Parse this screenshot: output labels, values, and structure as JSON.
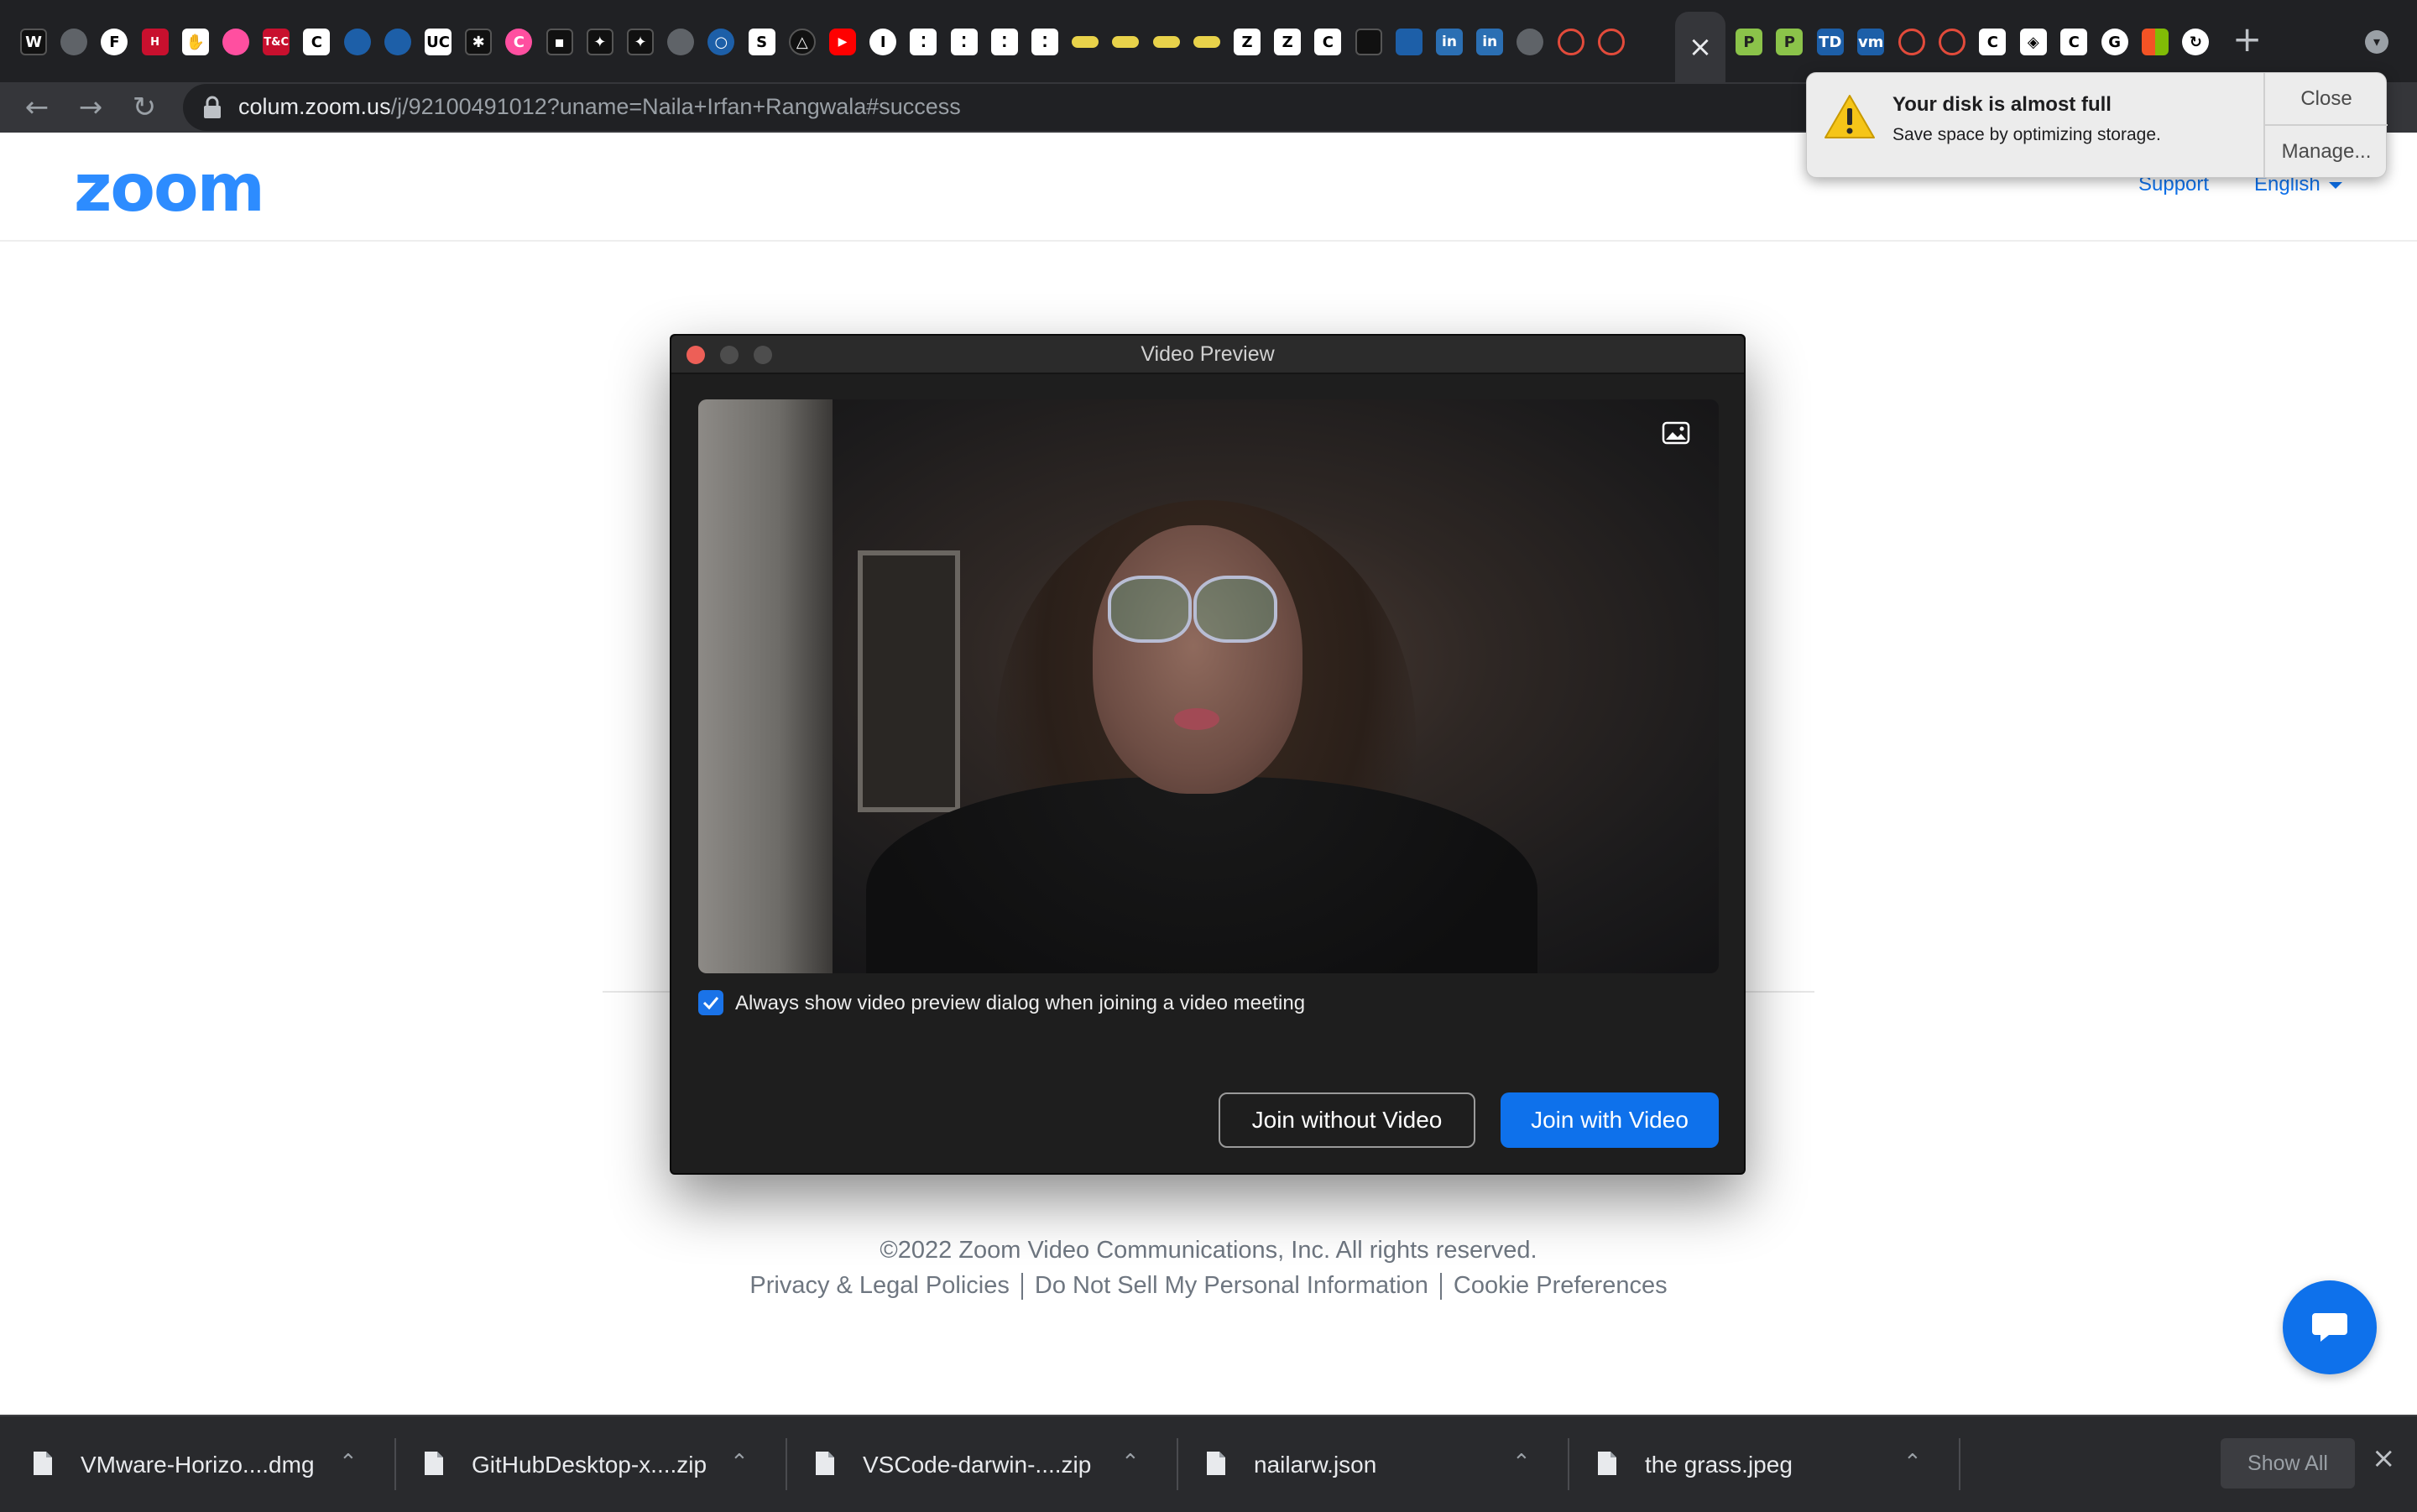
{
  "browser": {
    "url": {
      "host": "colum.zoom.us",
      "path": "/j/92100491012?uname=Naila+Irfan+Rangwala#success"
    },
    "tab_favicons": [
      {
        "icon": "wix-icon",
        "glyph": "W"
      },
      {
        "icon": "globe-icon",
        "glyph": ""
      },
      {
        "icon": "f-icon",
        "glyph": "F"
      },
      {
        "icon": "h-icon",
        "glyph": "H"
      },
      {
        "icon": "hand-icon",
        "glyph": "✋"
      },
      {
        "icon": "dribbble-icon",
        "glyph": ""
      },
      {
        "icon": "tc-icon",
        "glyph": "T&C"
      },
      {
        "icon": "c-icon",
        "glyph": "C"
      },
      {
        "icon": "circle-icon",
        "glyph": ""
      },
      {
        "icon": "circle-icon",
        "glyph": ""
      },
      {
        "icon": "uc-icon",
        "glyph": "UC"
      },
      {
        "icon": "rca-icon",
        "glyph": "✱"
      },
      {
        "icon": "canva-icon",
        "glyph": "C"
      },
      {
        "icon": "dark-icon",
        "glyph": "▪"
      },
      {
        "icon": "figma-icon",
        "glyph": "✦"
      },
      {
        "icon": "figma-icon",
        "glyph": "✦"
      },
      {
        "icon": "globe-icon",
        "glyph": ""
      },
      {
        "icon": "circle-icon",
        "glyph": "○"
      },
      {
        "icon": "s-icon",
        "glyph": "S"
      },
      {
        "icon": "triangle-icon",
        "glyph": "△"
      },
      {
        "icon": "youtube-icon",
        "glyph": "▶"
      },
      {
        "icon": "i-icon",
        "glyph": "I"
      },
      {
        "icon": "dots-icon",
        "glyph": "⁚"
      },
      {
        "icon": "dots-icon",
        "glyph": "⁚"
      },
      {
        "icon": "dots-icon",
        "glyph": "⁚"
      },
      {
        "icon": "dots-icon",
        "glyph": "⁚"
      },
      {
        "icon": "pill-icon",
        "glyph": ""
      },
      {
        "icon": "pill-icon",
        "glyph": ""
      },
      {
        "icon": "pill-icon",
        "glyph": ""
      },
      {
        "icon": "pill-icon",
        "glyph": ""
      },
      {
        "icon": "zara-icon",
        "glyph": "Z"
      },
      {
        "icon": "zara-icon",
        "glyph": "Z"
      },
      {
        "icon": "c-icon",
        "glyph": "C"
      },
      {
        "icon": "blank-icon",
        "glyph": ""
      },
      {
        "icon": "square-icon",
        "glyph": ""
      },
      {
        "icon": "linkedin-icon",
        "glyph": "in"
      },
      {
        "icon": "linkedin-icon",
        "glyph": "in"
      },
      {
        "icon": "globe-icon",
        "glyph": ""
      },
      {
        "icon": "ring-icon",
        "glyph": ""
      },
      {
        "icon": "ring-icon",
        "glyph": ""
      }
    ],
    "tab_favicons_right": [
      {
        "icon": "p-icon",
        "glyph": "P"
      },
      {
        "icon": "p-icon",
        "glyph": "P"
      },
      {
        "icon": "td-icon",
        "glyph": "TD"
      },
      {
        "icon": "vmware-icon",
        "glyph": "vm"
      },
      {
        "icon": "ring-icon",
        "glyph": ""
      },
      {
        "icon": "ring-icon",
        "glyph": ""
      },
      {
        "icon": "c-icon",
        "glyph": "C"
      },
      {
        "icon": "codepen-icon",
        "glyph": "◈"
      },
      {
        "icon": "c-icon",
        "glyph": "C"
      },
      {
        "icon": "google-icon",
        "glyph": "G"
      },
      {
        "icon": "microsoft-icon",
        "glyph": ""
      },
      {
        "icon": "refresh-red-icon",
        "glyph": "↻"
      }
    ]
  },
  "notification": {
    "title": "Your disk is almost full",
    "subtitle": "Save space by optimizing storage.",
    "close_label": "Close",
    "manage_label": "Manage..."
  },
  "zoom_page": {
    "logo": "zoom",
    "support_link": "Support",
    "language": "English",
    "footer_copyright": "©2022 Zoom Video Communications, Inc. All rights reserved.",
    "footer_links": [
      "Privacy & Legal Policies",
      "Do Not Sell My Personal Information",
      "Cookie Preferences"
    ]
  },
  "dialog": {
    "title": "Video Preview",
    "checkbox_label": "Always show video preview dialog when joining a video meeting",
    "checkbox_checked": true,
    "join_without_video": "Join without Video",
    "join_with_video": "Join with Video"
  },
  "downloads": {
    "items": [
      {
        "name": "VMware-Horizo....dmg"
      },
      {
        "name": "GitHubDesktop-x....zip"
      },
      {
        "name": "VSCode-darwin-....zip"
      },
      {
        "name": "nailarw.json"
      },
      {
        "name": "the grass.jpeg"
      }
    ],
    "show_all_label": "Show All"
  },
  "colors": {
    "zoom_blue": "#0e71eb",
    "dialog_bg": "#1e1e1e",
    "chrome_dark": "#202124"
  }
}
